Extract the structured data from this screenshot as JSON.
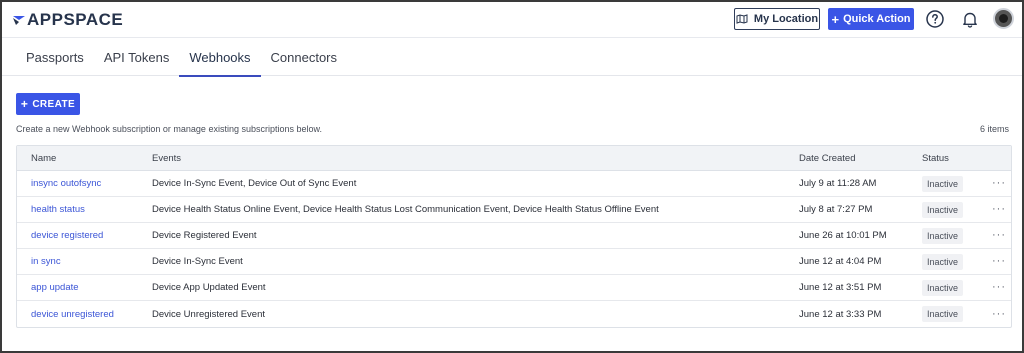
{
  "header": {
    "logo_text": "APPSPACE",
    "my_location_label": "My Location",
    "quick_action_label": "Quick Action"
  },
  "tabs": [
    {
      "label": "Passports",
      "active": false
    },
    {
      "label": "API Tokens",
      "active": false
    },
    {
      "label": "Webhooks",
      "active": true
    },
    {
      "label": "Connectors",
      "active": false
    }
  ],
  "toolbar": {
    "create_label": "CREATE",
    "description": "Create a new Webhook subscription or manage existing subscriptions below.",
    "item_count": "6 items"
  },
  "table": {
    "columns": {
      "name": "Name",
      "events": "Events",
      "date_created": "Date Created",
      "status": "Status"
    },
    "rows": [
      {
        "name": "insync outofsync",
        "events": "Device In-Sync Event, Device Out of Sync Event",
        "date": "July 9 at 11:28 AM",
        "status": "Inactive"
      },
      {
        "name": "health status",
        "events": "Device Health Status Online Event, Device Health Status Lost Communication Event, Device Health Status Offline Event",
        "date": "July 8 at 7:27 PM",
        "status": "Inactive"
      },
      {
        "name": "device registered",
        "events": "Device Registered Event",
        "date": "June 26 at 10:01 PM",
        "status": "Inactive"
      },
      {
        "name": "in sync",
        "events": "Device In-Sync Event",
        "date": "June 12 at 4:04 PM",
        "status": "Inactive"
      },
      {
        "name": "app update",
        "events": "Device App Updated Event",
        "date": "June 12 at 3:51 PM",
        "status": "Inactive"
      },
      {
        "name": "device unregistered",
        "events": "Device Unregistered Event",
        "date": "June 12 at 3:33 PM",
        "status": "Inactive"
      }
    ],
    "more_glyph": "···"
  },
  "colors": {
    "accent": "#3a55e6",
    "brand_dark": "#27344c",
    "link": "#3b55d6"
  },
  "icons": {
    "logo": "appspace-logo-icon",
    "location": "location-map-icon",
    "quick_action_plus": "plus-icon",
    "help": "help-circle-icon",
    "notifications": "bell-icon",
    "create_plus": "plus-icon",
    "row_menu": "more-horizontal-icon"
  }
}
